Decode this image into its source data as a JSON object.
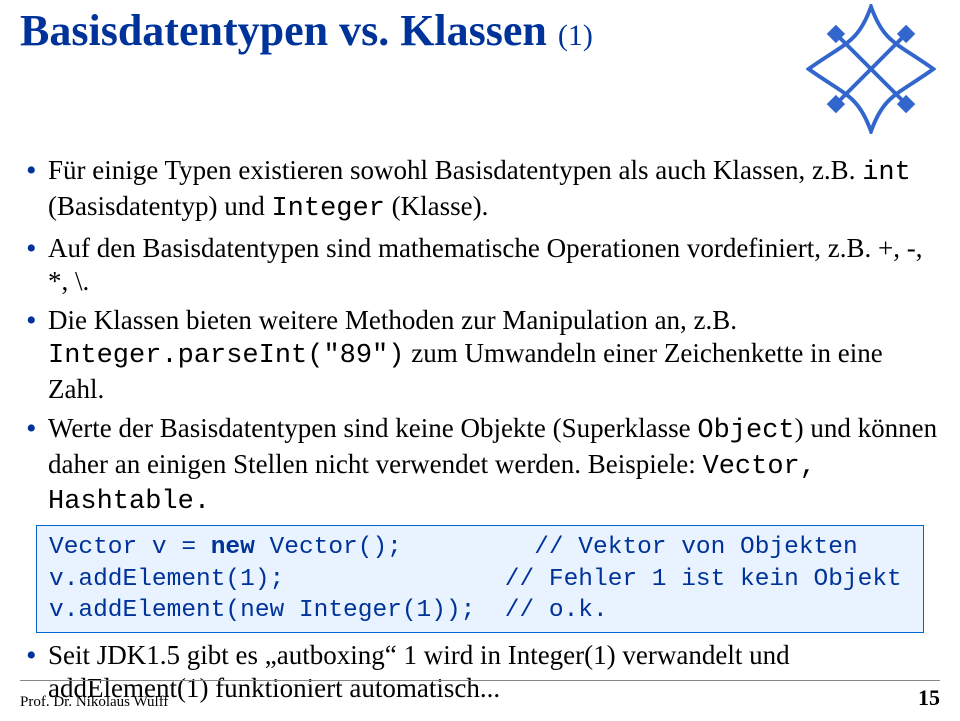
{
  "title": {
    "main": "Basisdatentypen vs. Klassen ",
    "sub": "(1)"
  },
  "bullets": {
    "b1": {
      "pre": "Für einige Typen existieren sowohl Basisdatentypen als auch Klassen, z.B. ",
      "code1": "int",
      "mid": " (Basisdatentyp) und ",
      "code2": "Integer",
      "post": " (Klasse)."
    },
    "b2": "Auf den Basisdatentypen sind mathematische Operationen vordefiniert, z.B. +, -, *, \\.",
    "b3": {
      "pre": "Die Klassen bieten weitere Methoden zur Manipulation an, z.B. ",
      "code": "Integer.parseInt(\"89\")",
      "post": " zum Umwandeln einer Zeichenkette in eine Zahl."
    },
    "b4": {
      "pre": "Werte der Basisdatentypen sind keine Objekte (Superklasse ",
      "code1": "Object",
      "mid": ") und können daher an einigen Stellen nicht verwendet werden. Beispiele: ",
      "code2": "Vector, Hashtable.",
      "post": ""
    },
    "b5": "Seit JDK1.5 gibt es „autboxing“ 1 wird in Integer(1) verwandelt und addElement(1) funktioniert automatisch..."
  },
  "code": {
    "l1a": "Vector v = ",
    "l1kw": "new",
    "l1b": " Vector();         // Vektor von Objekten",
    "l2": "v.addElement(1);               // Fehler 1 ist kein Objekt",
    "l3": "v.addElement(new Integer(1));  // o.k."
  },
  "footer": {
    "author": "Prof. Dr. Nikolaus Wulff",
    "page": "15"
  }
}
